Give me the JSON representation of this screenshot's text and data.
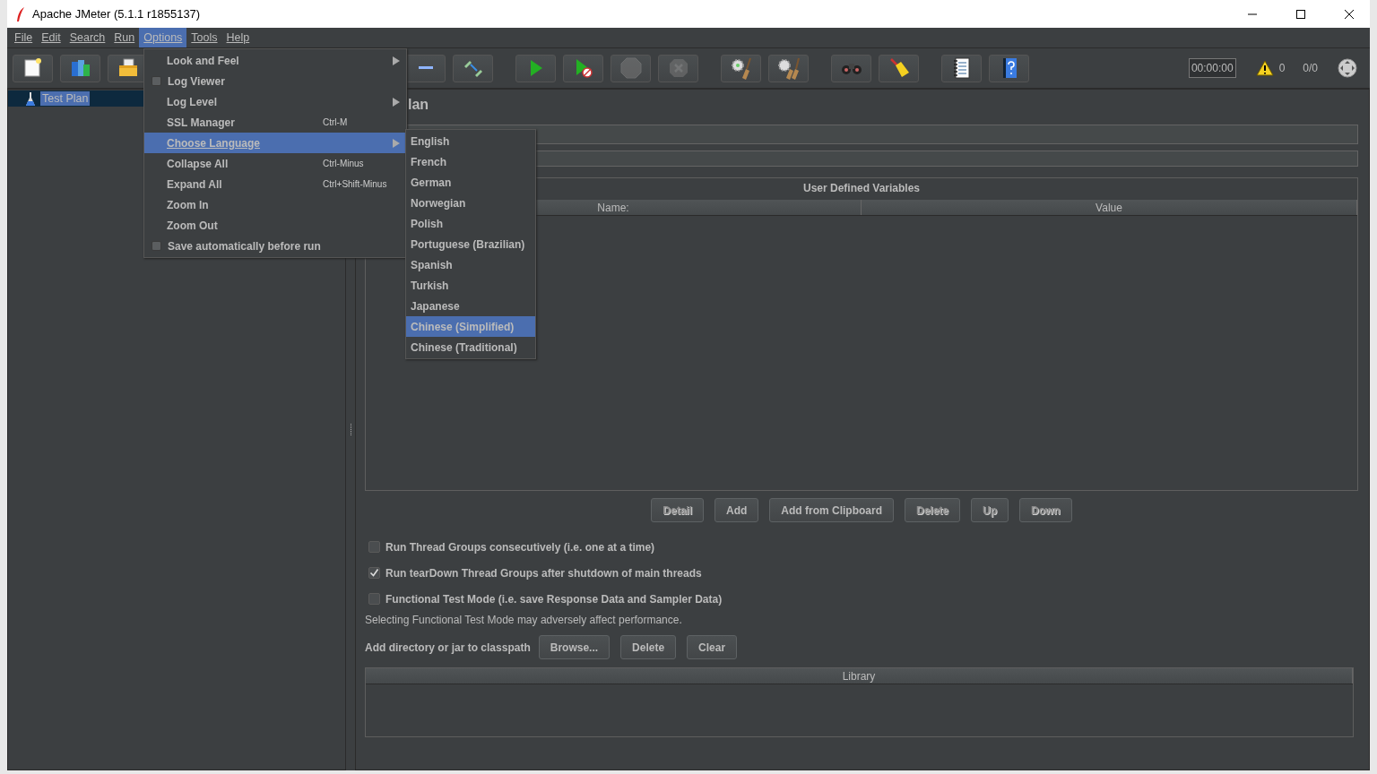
{
  "window": {
    "title": "Apache JMeter (5.1.1 r1855137)"
  },
  "menubar": [
    {
      "label": "File",
      "selected": false
    },
    {
      "label": "Edit",
      "selected": false
    },
    {
      "label": "Search",
      "selected": false
    },
    {
      "label": "Run",
      "selected": false
    },
    {
      "label": "Options",
      "selected": true
    },
    {
      "label": "Tools",
      "selected": false
    },
    {
      "label": "Help",
      "selected": false
    }
  ],
  "toolbar": {
    "buttons": [
      {
        "kind": "new",
        "disabled": false
      },
      {
        "kind": "templates",
        "disabled": false
      },
      {
        "kind": "open",
        "disabled": false
      },
      {
        "kind": "collapse",
        "disabled": false
      },
      {
        "kind": "toggle",
        "disabled": false
      },
      {
        "kind": "start",
        "disabled": false
      },
      {
        "kind": "startnopause",
        "disabled": false
      },
      {
        "kind": "stop",
        "disabled": true
      },
      {
        "kind": "shutdown",
        "disabled": true
      },
      {
        "kind": "clear",
        "disabled": false
      },
      {
        "kind": "clearall",
        "disabled": false
      },
      {
        "kind": "search",
        "disabled": false
      },
      {
        "kind": "resetsearch",
        "disabled": false
      },
      {
        "kind": "functions",
        "disabled": false
      },
      {
        "kind": "help",
        "disabled": false
      }
    ],
    "timer": "00:00:00",
    "warnings": "0",
    "threads": "0/0"
  },
  "tree": {
    "items": [
      {
        "label": "Test Plan",
        "selected": true
      }
    ]
  },
  "test_plan": {
    "title": "lan",
    "user_variables": {
      "title": "User Defined Variables",
      "columns": [
        "Name:",
        "Value"
      ],
      "buttons": [
        {
          "label": "Detail",
          "disabled": true
        },
        {
          "label": "Add",
          "disabled": false
        },
        {
          "label": "Add from Clipboard",
          "disabled": false
        },
        {
          "label": "Delete",
          "disabled": true
        },
        {
          "label": "Up",
          "disabled": true
        },
        {
          "label": "Down",
          "disabled": true
        }
      ]
    },
    "options": [
      {
        "label": "Run Thread Groups consecutively (i.e. one at a time)",
        "checked": false
      },
      {
        "label": "Run tearDown Thread Groups after shutdown of main threads",
        "checked": true
      },
      {
        "label": "Functional Test Mode (i.e. save Response Data and Sampler Data)",
        "checked": false
      }
    ],
    "note": "Selecting Functional Test Mode may adversely affect performance.",
    "classpath": {
      "label": "Add directory or jar to classpath",
      "buttons": [
        {
          "label": "Browse...",
          "disabled": false
        },
        {
          "label": "Delete",
          "disabled": false
        },
        {
          "label": "Clear",
          "disabled": false
        }
      ],
      "columns": [
        "Library"
      ]
    }
  },
  "options_menu": {
    "items": [
      {
        "kind": "submenu",
        "label": "Look and Feel",
        "selected": false
      },
      {
        "kind": "check",
        "label": "Log Viewer",
        "checked": false,
        "selected": false
      },
      {
        "kind": "submenu",
        "label": "Log Level",
        "selected": false
      },
      {
        "kind": "action",
        "label": "SSL Manager",
        "shortcut": "Ctrl-M",
        "selected": false
      },
      {
        "kind": "submenu",
        "label": "Choose Language",
        "selected": true
      },
      {
        "kind": "action",
        "label": "Collapse All",
        "shortcut": "Ctrl-Minus",
        "selected": false
      },
      {
        "kind": "action",
        "label": "Expand All",
        "shortcut": "Ctrl+Shift-Minus",
        "selected": false
      },
      {
        "kind": "action",
        "label": "Zoom In",
        "selected": false
      },
      {
        "kind": "action",
        "label": "Zoom Out",
        "selected": false
      },
      {
        "kind": "check",
        "label": "Save automatically before run",
        "checked": false,
        "selected": false
      }
    ]
  },
  "language_menu": {
    "items": [
      {
        "label": "English",
        "selected": false
      },
      {
        "label": "French",
        "selected": false
      },
      {
        "label": "German",
        "selected": false
      },
      {
        "label": "Norwegian",
        "selected": false
      },
      {
        "label": "Polish",
        "selected": false
      },
      {
        "label": "Portuguese (Brazilian)",
        "selected": false
      },
      {
        "label": "Spanish",
        "selected": false
      },
      {
        "label": "Turkish",
        "selected": false
      },
      {
        "label": "Japanese",
        "selected": false
      },
      {
        "label": "Chinese (Simplified)",
        "selected": true
      },
      {
        "label": "Chinese (Traditional)",
        "selected": false
      }
    ]
  }
}
